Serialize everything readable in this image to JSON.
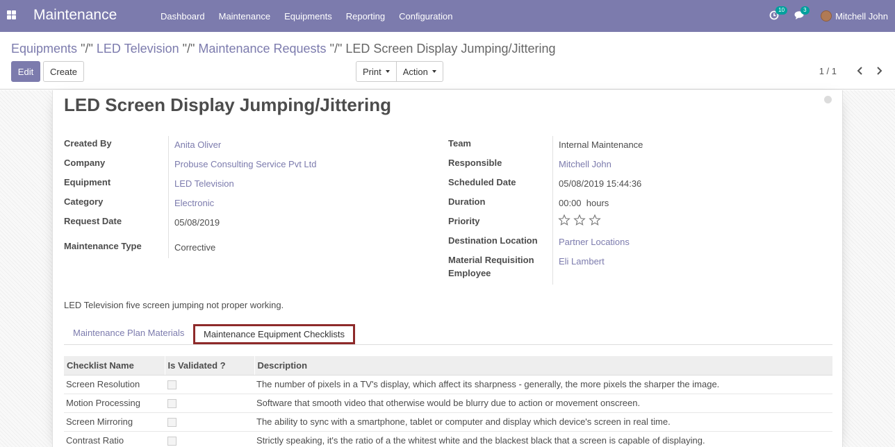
{
  "navbar": {
    "app_name": "Maintenance",
    "menu": [
      "Dashboard",
      "Maintenance",
      "Equipments",
      "Reporting",
      "Configuration"
    ],
    "activity_count": "10",
    "messages_count": "3",
    "user_name": "Mitchell John",
    "bg_color": "#7c7bad"
  },
  "breadcrumb": {
    "items": [
      "Equipments",
      "LED Television",
      "Maintenance Requests"
    ],
    "separator": "\"/\"",
    "current": "LED Screen Display Jumping/Jittering"
  },
  "toolbar": {
    "edit_label": "Edit",
    "create_label": "Create",
    "print_label": "Print",
    "action_label": "Action"
  },
  "pager": {
    "value": "1 / 1"
  },
  "form": {
    "title": "LED Screen Display Jumping/Jittering",
    "left": {
      "created_by": {
        "label": "Created By",
        "value": "Anita Oliver"
      },
      "company": {
        "label": "Company",
        "value": "Probuse Consulting Service Pvt Ltd"
      },
      "equipment": {
        "label": "Equipment",
        "value": "LED Television"
      },
      "category": {
        "label": "Category",
        "value": "Electronic"
      },
      "request_date": {
        "label": "Request Date",
        "value": "05/08/2019"
      },
      "maintenance_type": {
        "label": "Maintenance Type",
        "value": "Corrective"
      }
    },
    "right": {
      "team": {
        "label": "Team",
        "value": "Internal Maintenance"
      },
      "responsible": {
        "label": "Responsible",
        "value": "Mitchell John"
      },
      "scheduled_date": {
        "label": "Scheduled Date",
        "value": "05/08/2019 15:44:36"
      },
      "duration": {
        "label": "Duration",
        "value": "00:00  hours"
      },
      "priority": {
        "label": "Priority",
        "stars_filled": 0,
        "stars_total": 3
      },
      "destination_location": {
        "label": "Destination Location",
        "value": "Partner Locations"
      },
      "material_requisition_employee": {
        "label_line1": "Material Requisition",
        "label_line2": "Employee",
        "value": "Eli Lambert"
      }
    },
    "description": "LED Television five screen jumping not proper working."
  },
  "tabs": {
    "tab1": "Maintenance Plan Materials",
    "tab2": "Maintenance Equipment Checklists"
  },
  "checklist": {
    "headers": [
      "Checklist Name",
      "Is Validated ?",
      "Description"
    ],
    "rows": [
      {
        "name": "Screen Resolution",
        "validated": false,
        "description": "The number of pixels in a TV's display, which affect its sharpness - generally, the more pixels the sharper the image."
      },
      {
        "name": "Motion Processing",
        "validated": false,
        "description": "Software that smooth video that otherwise would be blurry due to action or movement onscreen."
      },
      {
        "name": "Screen Mirroring",
        "validated": false,
        "description": "The ability to sync with a smartphone, tablet or computer and display which device's screen in real time."
      },
      {
        "name": "Contrast Ratio",
        "validated": false,
        "description": "Strictly speaking, it's the ratio of a the whitest white and the blackest black that a screen is capable of displaying."
      }
    ]
  }
}
